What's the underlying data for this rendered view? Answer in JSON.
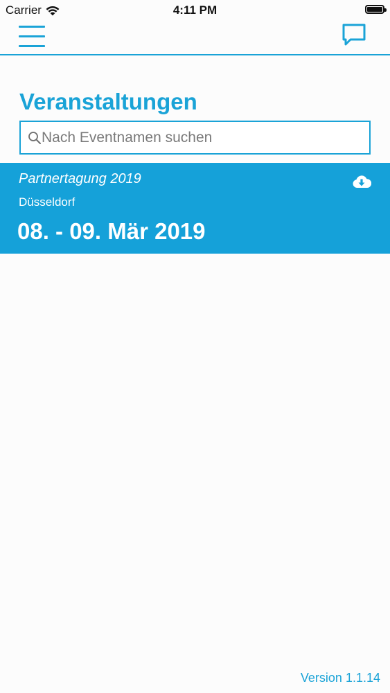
{
  "status_bar": {
    "carrier": "Carrier",
    "time": "4:11 PM",
    "battery_level": 1.0
  },
  "nav": {
    "menu_icon": "hamburger-menu-icon",
    "chat_icon": "chat-bubble-icon"
  },
  "page": {
    "title": "Veranstaltungen"
  },
  "search": {
    "placeholder": "Nach Eventnamen suchen",
    "value": "",
    "icon": "search-icon"
  },
  "events": [
    {
      "name": "Partnertagung 2019",
      "location": "Düsseldorf",
      "date": "08. - 09. Mär 2019",
      "action_icon": "cloud-download-icon"
    }
  ],
  "footer": {
    "version": "Version 1.1.14"
  },
  "colors": {
    "accent": "#1aa3d7",
    "card_background": "#15a1d9",
    "background": "#fcfcfc"
  }
}
